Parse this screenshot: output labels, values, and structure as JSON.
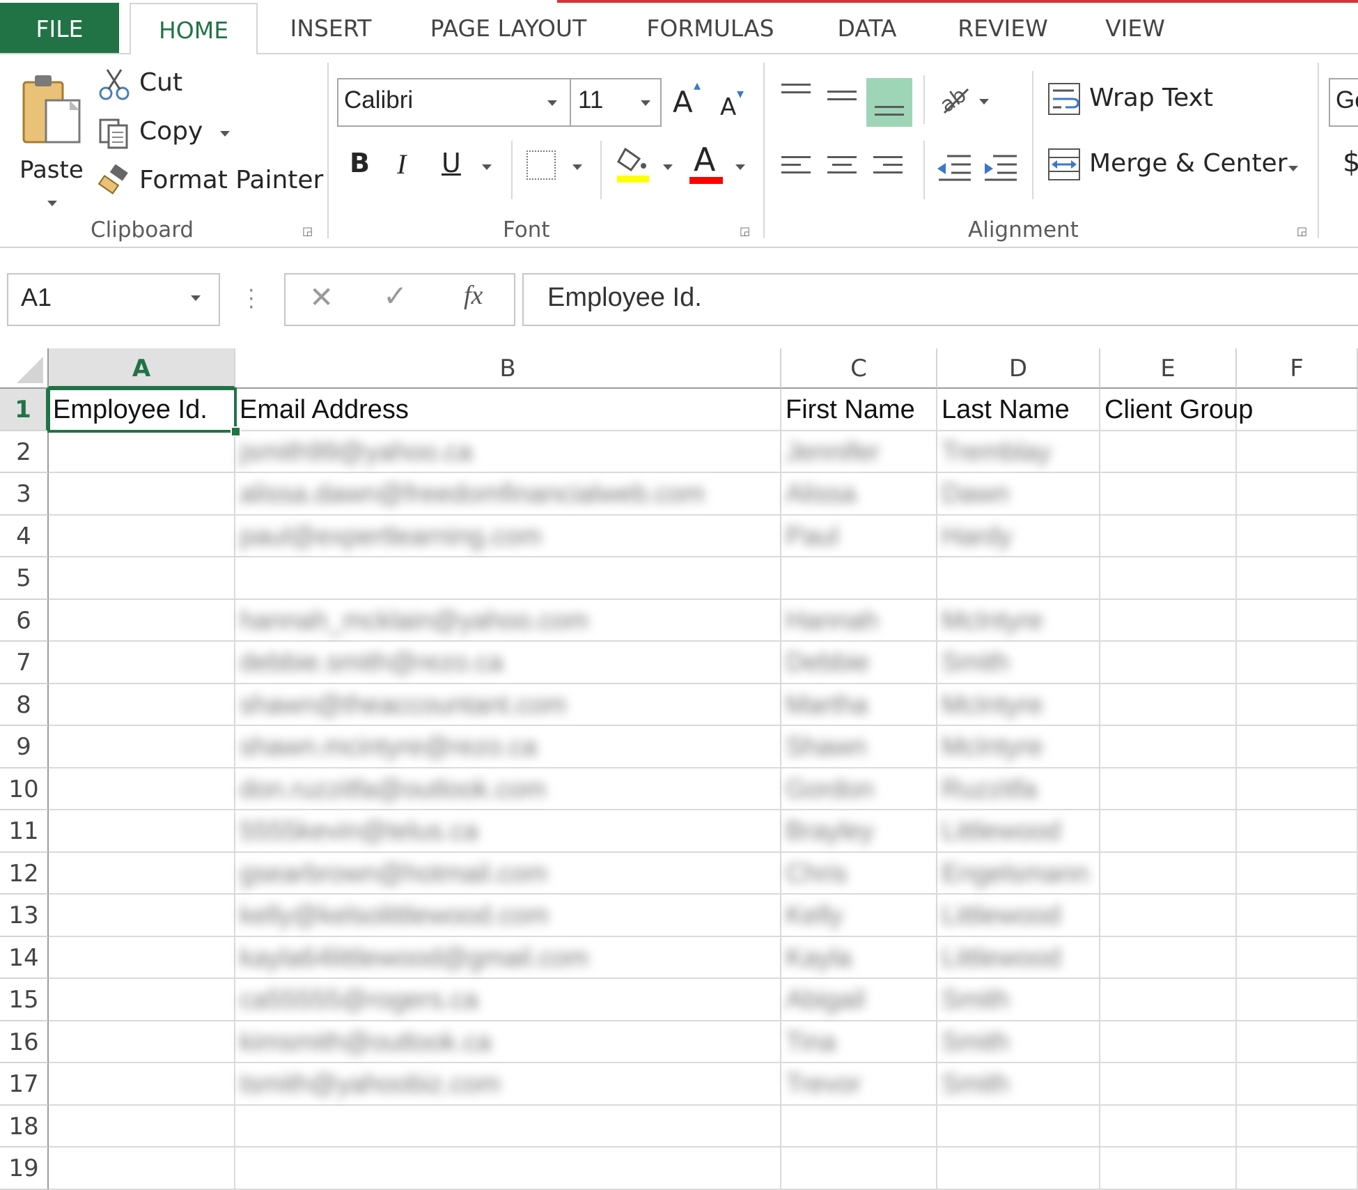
{
  "tabs": {
    "file": "FILE",
    "home": "HOME",
    "insert": "INSERT",
    "page_layout": "PAGE LAYOUT",
    "formulas": "FORMULAS",
    "data": "DATA",
    "review": "REVIEW",
    "view": "VIEW"
  },
  "clipboard": {
    "paste": "Paste",
    "cut": "Cut",
    "copy": "Copy",
    "format_painter": "Format Painter",
    "label": "Clipboard"
  },
  "font": {
    "name": "Calibri",
    "size": "11",
    "bold": "B",
    "italic": "I",
    "underline": "U",
    "font_color_glyph": "A",
    "grow": "A",
    "shrink": "A",
    "label": "Font",
    "fill_color": "#ffff00",
    "text_color": "#ff0000"
  },
  "alignment": {
    "wrap_text": "Wrap Text",
    "merge_center": "Merge & Center",
    "label": "Alignment"
  },
  "number": {
    "format_partial": "Ge",
    "currency_partial": "$"
  },
  "formula_bar": {
    "name_box": "A1",
    "fx": "fx",
    "content": "Employee Id."
  },
  "columns": [
    "A",
    "B",
    "C",
    "D",
    "E",
    "F"
  ],
  "rows": [
    "1",
    "2",
    "3",
    "4",
    "5",
    "6",
    "7",
    "8",
    "9",
    "10",
    "11",
    "12",
    "13",
    "14",
    "15",
    "16",
    "17",
    "18",
    "19"
  ],
  "headers": {
    "A1": "Employee Id.",
    "B1": "Email Address",
    "C1": "First Name",
    "D1": "Last Name",
    "E1": "Client Group"
  },
  "blurred_rows": [
    {
      "row": "2",
      "email": "jsmith99@yahoo.ca",
      "first": "Jennifer",
      "last": "Tremblay"
    },
    {
      "row": "3",
      "email": "alissa.dawn@freedomfinancialweb.com",
      "first": "Alissa",
      "last": "Dawn"
    },
    {
      "row": "4",
      "email": "paul@expertlearning.com",
      "first": "Paul",
      "last": "Hardy"
    },
    {
      "row": "5",
      "email": "",
      "first": "",
      "last": ""
    },
    {
      "row": "6",
      "email": "hannah_mcklain@yahoo.com",
      "first": "Hannah",
      "last": "McIntyre"
    },
    {
      "row": "7",
      "email": "debbie.smith@rezo.ca",
      "first": "Debbie",
      "last": "Smith"
    },
    {
      "row": "8",
      "email": "shawn@theaccountant.com",
      "first": "Martha",
      "last": "McIntyre"
    },
    {
      "row": "9",
      "email": "shawn.mcintyre@rezo.ca",
      "first": "Shawn",
      "last": "McIntyre"
    },
    {
      "row": "10",
      "email": "don.ruzzitfa@outlook.com",
      "first": "Gordon",
      "last": "Ruzzitfa"
    },
    {
      "row": "11",
      "email": "5555kevin@telus.ca",
      "first": "Brayley",
      "last": "Littlewood"
    },
    {
      "row": "12",
      "email": "gsearbrown@hotmail.com",
      "first": "Chris",
      "last": "Engelsmann"
    },
    {
      "row": "13",
      "email": "kelly@kelsolittlewood.com",
      "first": "Kelly",
      "last": "Littlewood"
    },
    {
      "row": "14",
      "email": "kayla64littlewood@gmail.com",
      "first": "Kayla",
      "last": "Littlewood"
    },
    {
      "row": "15",
      "email": "ca55555@rogers.ca",
      "first": "Abigail",
      "last": "Smith"
    },
    {
      "row": "16",
      "email": "kimsmith@outlook.ca",
      "first": "Tina",
      "last": "Smith"
    },
    {
      "row": "17",
      "email": "tsmith@yahoobiz.com",
      "first": "Trevor",
      "last": "Smith"
    }
  ],
  "colors": {
    "excel_green": "#217346",
    "red_accent": "#d13438"
  }
}
